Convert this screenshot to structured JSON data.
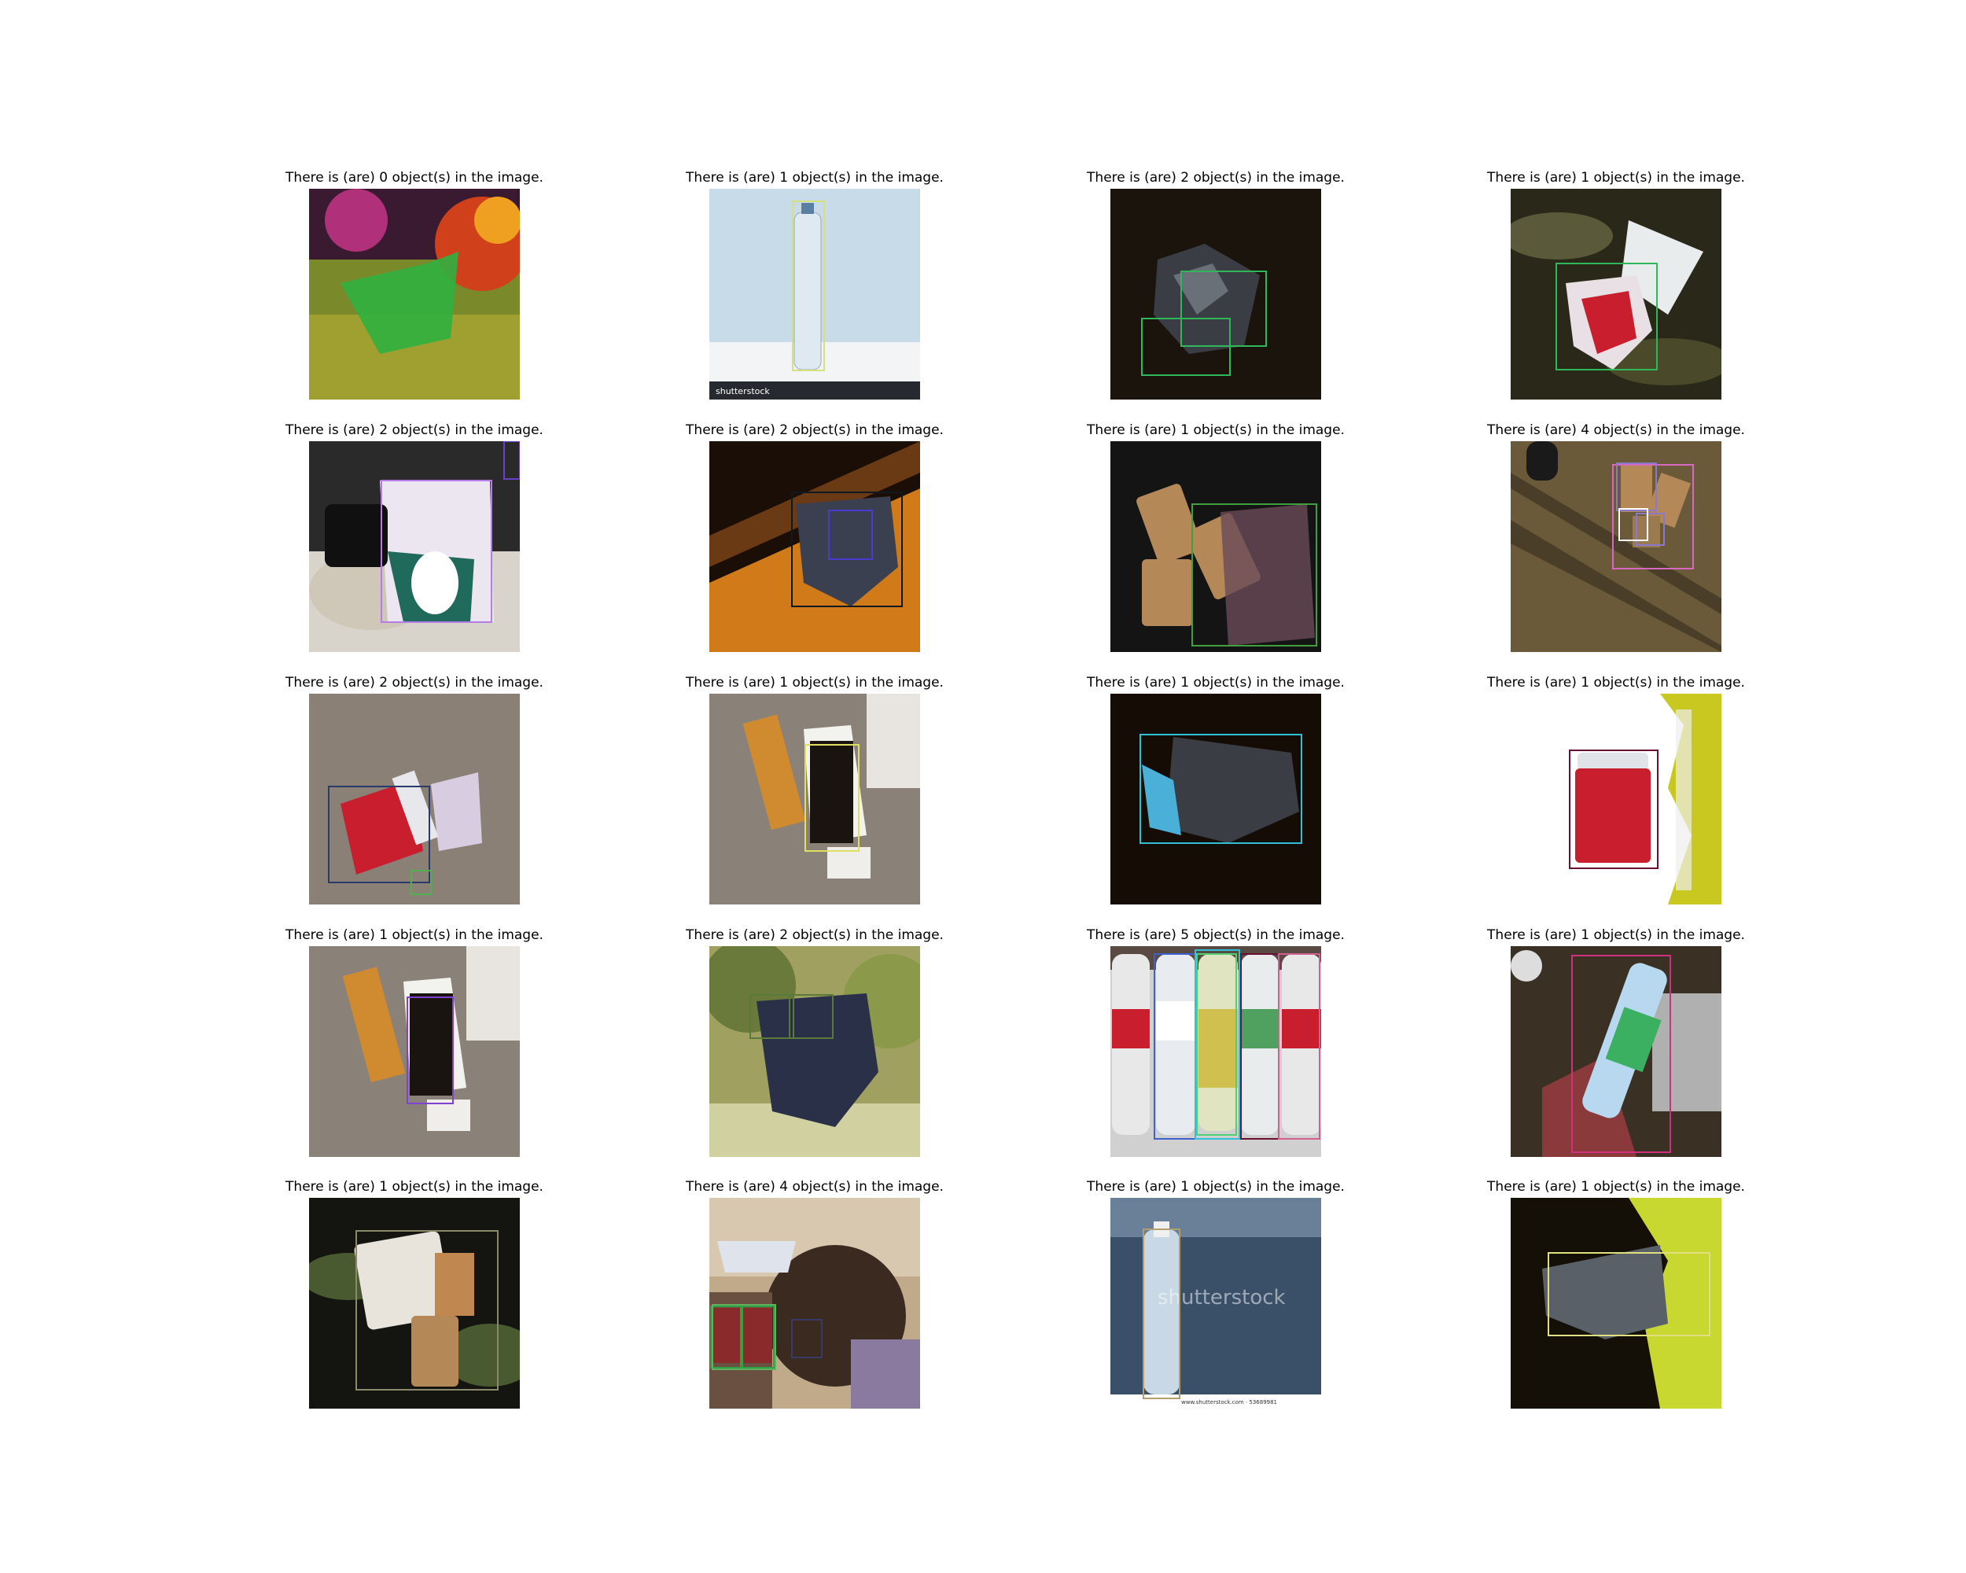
{
  "captions": [
    "There is (are) 0 object(s) in the image.",
    "There is (are) 1 object(s) in the image.",
    "There is (are) 2 object(s) in the image.",
    "There is (are) 1 object(s) in the image.",
    "There is (are) 2 object(s) in the image.",
    "There is (are) 2 object(s) in the image.",
    "There is (are) 1 object(s) in the image.",
    "There is (are) 4 object(s) in the image.",
    "There is (are) 2 object(s) in the image.",
    "There is (are) 1 object(s) in the image.",
    "There is (are) 1 object(s) in the image.",
    "There is (are) 1 object(s) in the image.",
    "There is (are) 1 object(s) in the image.",
    "There is (are) 2 object(s) in the image.",
    "There is (are) 5 object(s) in the image.",
    "There is (are) 1 object(s) in the image.",
    "There is (are) 1 object(s) in the image.",
    "There is (are) 4 object(s) in the image.",
    "There is (are) 1 object(s) in the image.",
    "There is (are) 1 object(s) in the image."
  ],
  "watermarks": {
    "shutterstock": "shutterstock",
    "shutterstock_url": "www.shutterstock.com · 53689981"
  }
}
